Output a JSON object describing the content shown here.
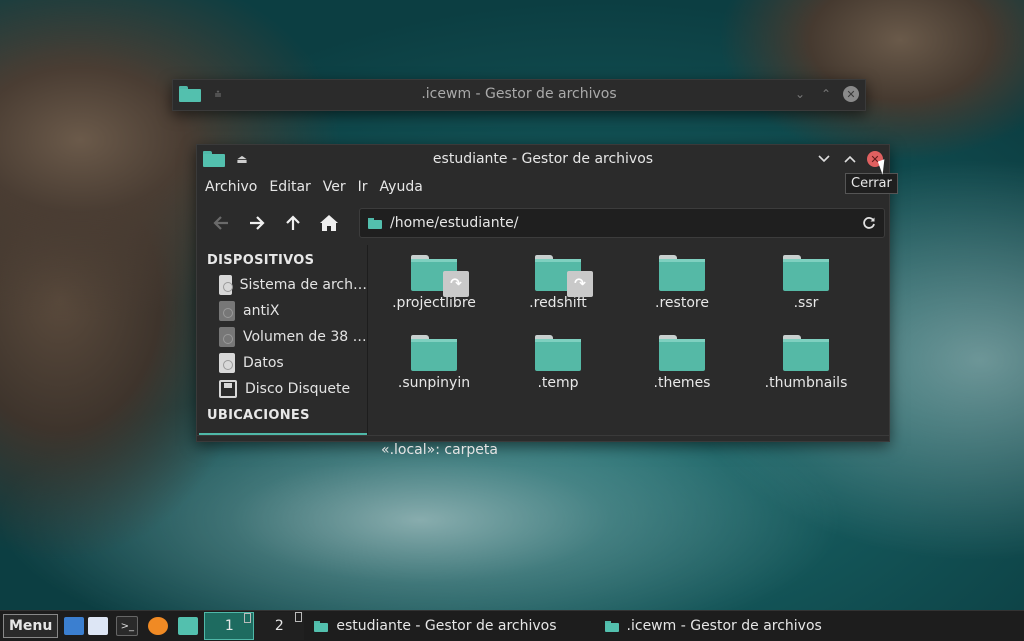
{
  "back_window": {
    "title": ".icewm - Gestor de archivos"
  },
  "window": {
    "title": "estudiante - Gestor de archivos",
    "menu": [
      "Archivo",
      "Editar",
      "Ver",
      "Ir",
      "Ayuda"
    ],
    "path": "/home/estudiante/",
    "sidebar": {
      "devices_header": "DISPOSITIVOS",
      "devices": [
        "Sistema de arch…",
        "antiX",
        "Volumen de 38 …",
        "Datos",
        "Disco Disquete"
      ],
      "places_header": "UBICACIONES"
    },
    "files": [
      {
        "name": ".projectlibre",
        "link": true
      },
      {
        "name": ".redshift",
        "link": true
      },
      {
        "name": ".restore",
        "link": false
      },
      {
        "name": ".ssr",
        "link": false
      },
      {
        "name": ".sunpinyin",
        "link": false
      },
      {
        "name": ".temp",
        "link": false
      },
      {
        "name": ".themes",
        "link": false
      },
      {
        "name": ".thumbnails",
        "link": false
      }
    ],
    "status": "«.local»: carpeta"
  },
  "tooltip": "Cerrar",
  "taskbar": {
    "menu_label": "Menu",
    "workspaces": [
      "1",
      "2"
    ],
    "tasks": [
      "estudiante - Gestor de archivos",
      ".icewm - Gestor de archivos"
    ]
  },
  "colors": {
    "accent": "#4fb8a8",
    "close_red": "#e06060",
    "window_bg": "#2b2b2b"
  }
}
